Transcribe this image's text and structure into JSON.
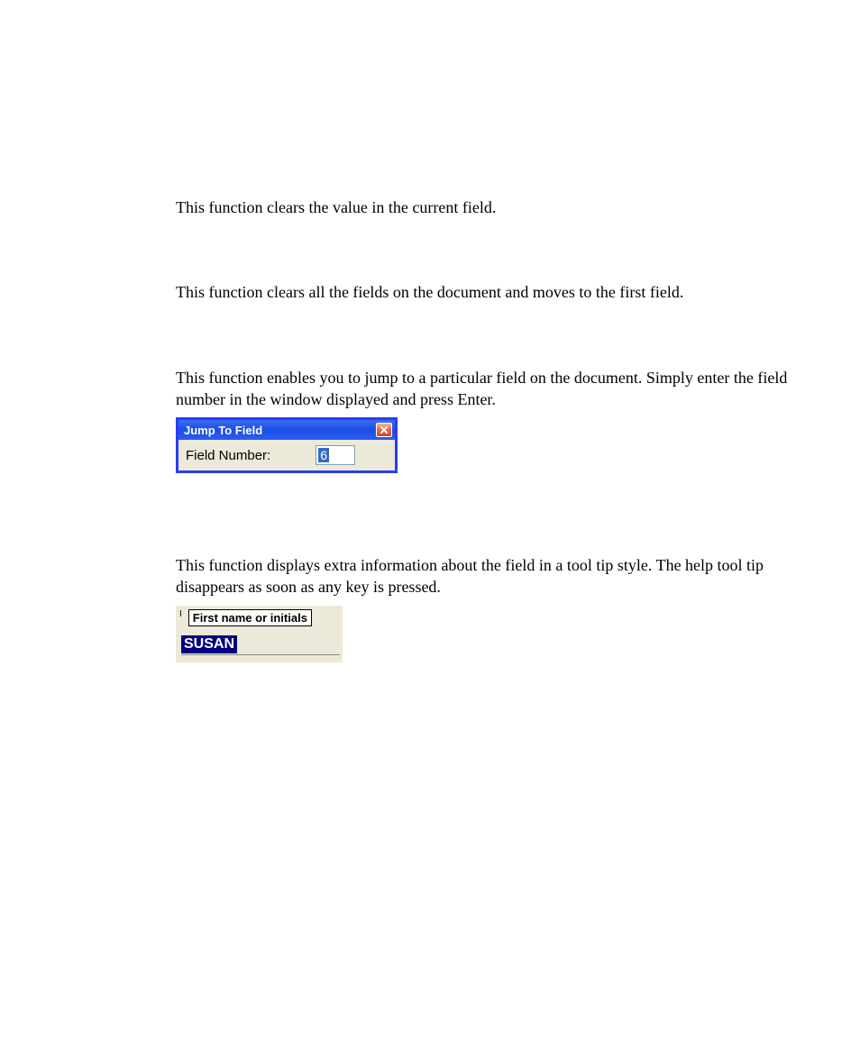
{
  "paragraphs": {
    "clearField": "This function clears the value in the current field.",
    "clearAllFields": "This function clears all the fields on the document and moves to the first field.",
    "jumpToField": "This function enables you to jump to a particular field on the document. Simply enter the field number in the window displayed and press Enter.",
    "fieldHelp": "This function displays extra information about the field in a tool tip style. The help tool tip disappears as soon as any key is pressed."
  },
  "jumpDialog": {
    "title": "Jump To Field",
    "label": "Field Number:",
    "value": "6"
  },
  "tooltipFigure": {
    "tooltipText": "First name or initials",
    "fieldValue": "SUSAN"
  }
}
